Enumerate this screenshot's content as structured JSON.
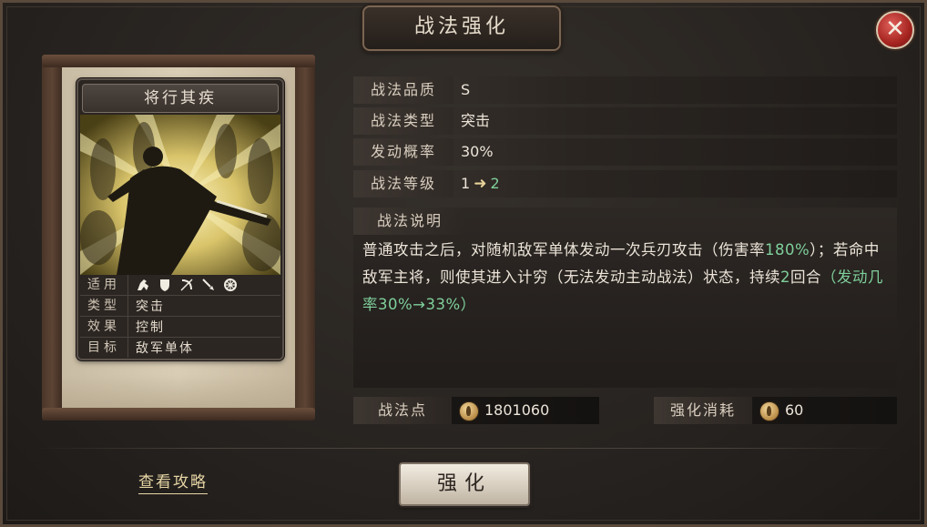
{
  "window": {
    "title": "战法强化",
    "close_label": "✕"
  },
  "card": {
    "name": "将行其疾",
    "rows": [
      {
        "key": "适用",
        "value": ""
      },
      {
        "key": "类型",
        "value": "突击"
      },
      {
        "key": "效果",
        "value": "控制"
      },
      {
        "key": "目标",
        "value": "敌军单体"
      }
    ],
    "unit_icons": [
      "cavalry-icon",
      "shield-icon",
      "archer-icon",
      "spear-icon",
      "chariot-icon"
    ]
  },
  "stats": [
    {
      "label": "战法品质",
      "value": "S"
    },
    {
      "label": "战法类型",
      "value": "突击"
    },
    {
      "label": "发动概率",
      "value": "30%"
    }
  ],
  "level": {
    "label": "战法等级",
    "from": "1",
    "arrow": "➜",
    "to": "2"
  },
  "description": {
    "title": "战法说明",
    "part1": "普通攻击之后，对随机敌军单体发动一次兵刃攻击（伤害率",
    "part2_green": "180%",
    "part3": "）；若命中敌军主将，则使其进入计穷（无法发动主动战法）状态，持续",
    "part4_green": "2",
    "part5": "回合",
    "part6_green": "（发动几率30%→33%）"
  },
  "resources": {
    "points_label": "战法点",
    "points_value": "1801060",
    "cost_label": "强化消耗",
    "cost_value": "60"
  },
  "footer": {
    "guide_link": "查看攻略",
    "upgrade_button": "强化"
  },
  "colors": {
    "accent_green": "#7fcf9b",
    "close_red": "#a52420",
    "link_gold": "#e7d6a5"
  }
}
